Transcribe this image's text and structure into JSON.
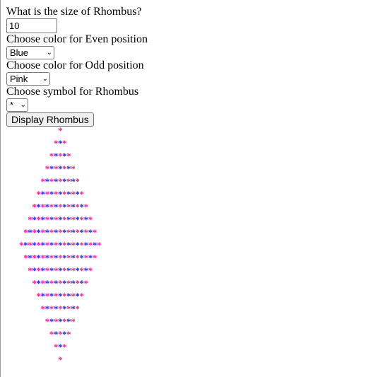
{
  "form": {
    "size_label": "What is the size of Rhombus?",
    "size_value": "10",
    "even_label": "Choose color for Even position",
    "even_selected": "Blue",
    "odd_label": "Choose color for Odd position",
    "odd_selected": "Pink",
    "symbol_label": "Choose symbol for Rhombus",
    "symbol_selected": "*",
    "display_button": "Display Rhombus"
  },
  "rhombus": {
    "size": 10,
    "symbol": "*",
    "even_color": "#1a1aff",
    "odd_color": "#ff1493"
  }
}
